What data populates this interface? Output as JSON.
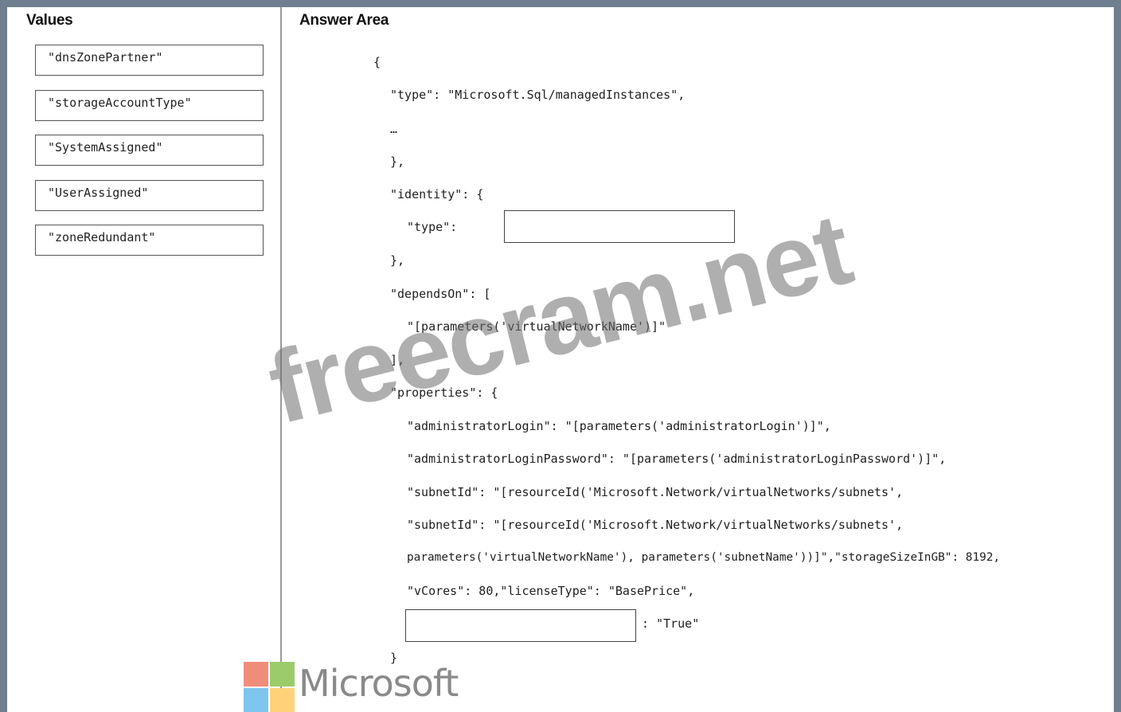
{
  "values_panel": {
    "heading": "Values",
    "items": [
      "\"dnsZonePartner\"",
      "\"storageAccountType\"",
      "\"SystemAssigned\"",
      "\"UserAssigned\"",
      "\"zoneRedundant\""
    ]
  },
  "answer_area": {
    "heading": "Answer Area",
    "lines": [
      "{",
      "\"type\": \"Microsoft.Sql/managedInstances\",",
      "…",
      "},",
      "\"identity\": {",
      "\"type\":",
      "},",
      "\"dependsOn\": [",
      "\"[parameters('virtualNetworkName')]\"",
      "],",
      "\"properties\": {",
      "\"administratorLogin\": \"[parameters('administratorLogin')]\",",
      "\"administratorLoginPassword\": \"[parameters('administratorLoginPassword')]\",",
      "\"subnetId\": \"[resourceId('Microsoft.Network/virtualNetworks/subnets',",
      "\"subnetId\": \"[resourceId('Microsoft.Network/virtualNetworks/subnets',",
      "parameters('virtualNetworkName'), parameters('subnetName'))]\",\"storageSizeInGB\": 8192,",
      "\"vCores\": 80,\"licenseType\": \"BasePrice\",",
      ": \"True\"",
      "}"
    ]
  },
  "watermark": "freecram.net",
  "brand": {
    "name": "Microsoft",
    "colors": [
      "#f25022",
      "#7fba00",
      "#00a4ef",
      "#ffb900"
    ]
  }
}
